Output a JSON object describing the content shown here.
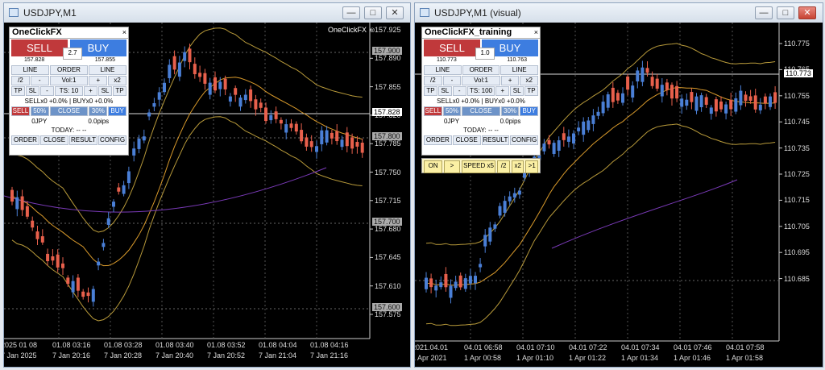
{
  "left": {
    "title": "USDJPY,M1",
    "ea_label": "OneClickFX ☺",
    "price_levels": [
      "157.925",
      "157.890",
      "157.855",
      "157.820",
      "157.785",
      "157.750",
      "157.715",
      "157.680",
      "157.645",
      "157.610",
      "157.575"
    ],
    "tags": {
      "p1": "157.900",
      "p2": "157.828",
      "p3": "157.800",
      "p4": "157.700",
      "p5": "157.600"
    },
    "time_top": [
      "2025 01 08",
      "01.08 03:16",
      "01.08 03:28",
      "01.08 03:40",
      "01.08 03:52",
      "01.08 04:04",
      "01.08 04:16"
    ],
    "time_bottom": [
      "7 Jan 2025",
      "7 Jan 20:16",
      "7 Jan 20:28",
      "7 Jan 20:40",
      "7 Jan 20:52",
      "7 Jan 21:04",
      "7 Jan 21:16"
    ],
    "panel": {
      "title": "OneClickFX",
      "close": "×",
      "sell": "SELL",
      "buy": "BUY",
      "spread": "2.7",
      "bid": "157.828",
      "ask": "157.855",
      "line1": "LINE",
      "order": "ORDER",
      "line2": "LINE",
      "div2": "/2",
      "minus1": "-",
      "vol": "Vol:1",
      "plus1": "+",
      "x2": "x2",
      "tp1": "TP",
      "sl1": "SL",
      "minus2": "-",
      "ts": "TS: 10",
      "plus2": "+",
      "sl2": "SL",
      "tp2": "TP",
      "pos": "SELLx0 +0.0% | BUYx0 +0.0%",
      "sellb": "SELL",
      "p50": "50%",
      "closeb": "CLOSE",
      "p30": "30%",
      "buyb": "BUY",
      "jpy": "0JPY",
      "pips": "0.0pips",
      "today": "TODAY: -- --",
      "b_order": "ORDER",
      "b_close": "CLOSE",
      "b_result": "RESULT",
      "b_config": "CONFIG"
    }
  },
  "right": {
    "title": "USDJPY,M1 (visual)",
    "price_levels": [
      "110.775",
      "110.765",
      "110.755",
      "110.745",
      "110.735",
      "110.725",
      "110.715",
      "110.705",
      "110.695",
      "110.685"
    ],
    "tags": {
      "cur": "110.773"
    },
    "time_top": [
      "2021.04.01",
      "04.01 06:58",
      "04.01 07:10",
      "04.01 07:22",
      "04.01 07:34",
      "04.01 07:46",
      "04.01 07:58"
    ],
    "time_bottom": [
      "1 Apr 2021",
      "1 Apr 00:58",
      "1 Apr 01:10",
      "1 Apr 01:22",
      "1 Apr 01:34",
      "1 Apr 01:46",
      "1 Apr 01:58"
    ],
    "panel": {
      "title": "OneClickFX_training",
      "close": "×",
      "sell": "SELL",
      "buy": "BUY",
      "spread": "1.0",
      "bid": "110.773",
      "ask": "110.763",
      "line1": "LINE",
      "order": "ORDER",
      "line2": "LINE",
      "div2": "/2",
      "minus1": "-",
      "vol": "Vol:1",
      "plus1": "+",
      "x2": "x2",
      "tp1": "TP",
      "sl1": "SL",
      "minus2": "-",
      "ts": "TS: 100",
      "plus2": "+",
      "sl2": "SL",
      "tp2": "TP",
      "pos": "SELLx0 +0.0% | BUYx0 +0.0%",
      "sellb": "SELL",
      "p50": "50%",
      "closeb": "CLOSE",
      "p30": "30%",
      "buyb": "BUY",
      "jpy": "0JPY",
      "pips": "0.0pips",
      "today": "TODAY: -- --",
      "b_order": "ORDER",
      "b_close": "CLOSE",
      "b_result": "RESULT",
      "b_config": "CONFIG"
    },
    "controls": {
      "on": "ON",
      "step": ">",
      "speed": "SPEED x5",
      "half": "/2",
      "double": "x2",
      "one": ">1"
    }
  },
  "window_buttons": {
    "min": "—",
    "max": "□",
    "close": "✕"
  },
  "colors": {
    "bull": "#4a7fd6",
    "bear": "#e8604c",
    "ma": "#d99a2b",
    "band": "#b89a3a",
    "slow_ma": "#7a3ab8",
    "grid": "#555555"
  }
}
